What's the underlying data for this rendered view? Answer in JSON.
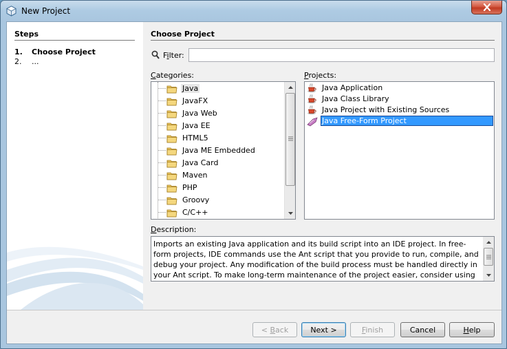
{
  "window": {
    "title": "New Project"
  },
  "steps": {
    "title": "Steps",
    "items": [
      {
        "num": "1.",
        "label": "Choose Project"
      },
      {
        "num": "2.",
        "label": "..."
      }
    ]
  },
  "panel": {
    "title": "Choose Project"
  },
  "filter": {
    "label_pre": "F",
    "label_underline": "i",
    "label_post": "lter:",
    "value": ""
  },
  "categories": {
    "label_underline": "C",
    "label_rest": "ategories:",
    "items": [
      "Java",
      "JavaFX",
      "Java Web",
      "Java EE",
      "HTML5",
      "Java ME Embedded",
      "Java Card",
      "Maven",
      "PHP",
      "Groovy",
      "C/C++"
    ],
    "selected": "Java"
  },
  "projects": {
    "label_underline": "P",
    "label_rest": "rojects:",
    "items": [
      "Java Application",
      "Java Class Library",
      "Java Project with Existing Sources",
      "Java Free-Form Project"
    ],
    "selected": "Java Free-Form Project"
  },
  "description": {
    "label_underline": "D",
    "label_rest": "escription:",
    "text": "Imports an existing Java application and its build script into an IDE project. In free-form projects, IDE commands use the Ant script that you provide to run, compile, and debug your project. Any modification of the build process must be handled directly in your Ant script. To make long-term maintenance of the project easier, consider using the Java Project with Existing Sources project template."
  },
  "buttons": {
    "back": {
      "pre": "< ",
      "underline": "B",
      "post": "ack"
    },
    "next": {
      "pre": "Next ",
      "underline": "",
      "post": ">"
    },
    "finish": {
      "pre": "",
      "underline": "F",
      "post": "inish"
    },
    "cancel": {
      "pre": "Cancel",
      "underline": "",
      "post": ""
    },
    "help": {
      "pre": "",
      "underline": "H",
      "post": "elp"
    }
  },
  "colors": {
    "selection": "#3399ff",
    "titlebar": "#aecbe3",
    "close": "#c23a22"
  }
}
